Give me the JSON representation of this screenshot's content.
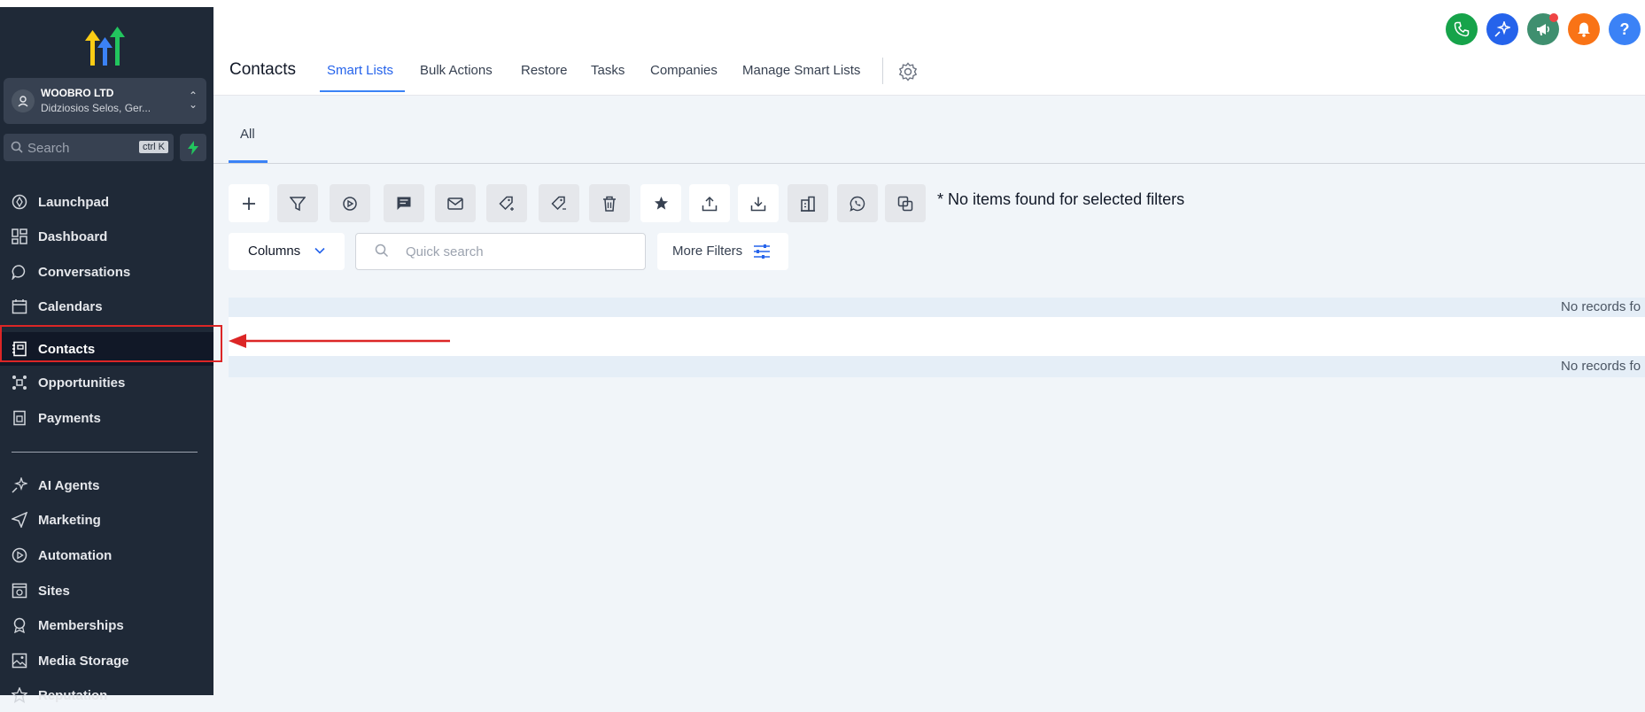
{
  "brand": {
    "logo": "gohighlevel-logo"
  },
  "account": {
    "name": "WOOBRO LTD",
    "location": "Didziosios Selos, Ger..."
  },
  "search": {
    "placeholder": "Search",
    "shortcut": "ctrl K"
  },
  "sidebar": {
    "items": [
      {
        "label": "Launchpad",
        "icon": "rocket-icon"
      },
      {
        "label": "Dashboard",
        "icon": "grid-icon"
      },
      {
        "label": "Conversations",
        "icon": "chat-bubble-icon"
      },
      {
        "label": "Calendars",
        "icon": "calendar-icon"
      },
      {
        "label": "Contacts",
        "icon": "contacts-book-icon",
        "active": true
      },
      {
        "label": "Opportunities",
        "icon": "funnel-nodes-icon"
      },
      {
        "label": "Payments",
        "icon": "payment-doc-icon"
      },
      {
        "label": "AI Agents",
        "icon": "sparkle-icon"
      },
      {
        "label": "Marketing",
        "icon": "send-icon"
      },
      {
        "label": "Automation",
        "icon": "play-circle-icon"
      },
      {
        "label": "Sites",
        "icon": "sites-icon"
      },
      {
        "label": "Memberships",
        "icon": "badge-icon"
      },
      {
        "label": "Media Storage",
        "icon": "image-icon"
      },
      {
        "label": "Reputation",
        "icon": "star-icon"
      }
    ]
  },
  "header": {
    "title": "Contacts",
    "tabs": [
      {
        "label": "Smart Lists",
        "active": true
      },
      {
        "label": "Bulk Actions"
      },
      {
        "label": "Restore"
      },
      {
        "label": "Tasks"
      },
      {
        "label": "Companies"
      },
      {
        "label": "Manage Smart Lists"
      }
    ],
    "help_label": "?",
    "colors": {
      "phone": "#16a34a",
      "ai": "#2563eb",
      "announce": "#3f8f6f",
      "bell": "#f97316",
      "help": "#3b82f6"
    }
  },
  "subtabs": {
    "active": "All"
  },
  "toolbar": {
    "icons": [
      "plus-icon",
      "filter-icon",
      "workflow-icon",
      "sms-icon",
      "email-icon",
      "add-tag-icon",
      "remove-tag-icon",
      "delete-icon",
      "star-icon",
      "export-icon",
      "import-icon",
      "company-icon",
      "whatsapp-icon",
      "duplicate-icon"
    ],
    "status_text": "* No items found for selected filters"
  },
  "filters": {
    "columns_label": "Columns",
    "quick_search_placeholder": "Quick search",
    "more_filters_label": "More Filters"
  },
  "table": {
    "empty_text": "No records fo"
  }
}
